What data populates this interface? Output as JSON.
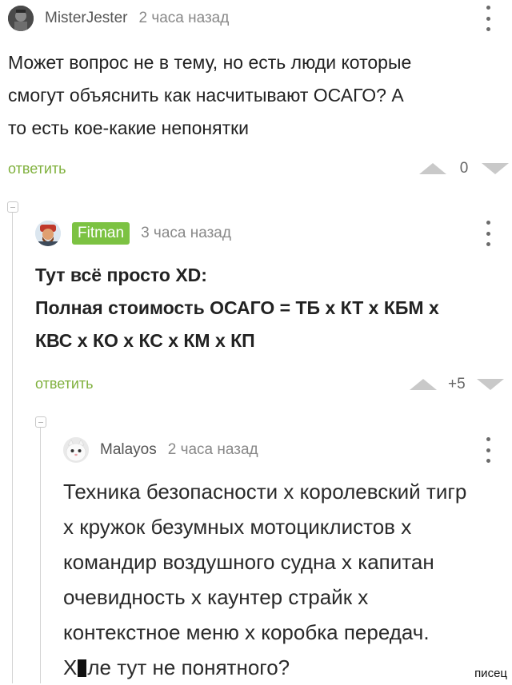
{
  "comments": [
    {
      "author": "MisterJester",
      "time": "2 часа назад",
      "text": "Может вопрос не в тему, но есть люди которые\nсмогут объяснить как насчитывают ОСАГО? А\nто есть кое-какие непонятки",
      "reply_label": "ответить",
      "score": "0"
    },
    {
      "author": "Fitman",
      "time": "3 часа назад",
      "text": "Тут всё просто XD:\nПолная стоимость ОСАГО = ТБ х КТ х КБМ х\nКВС х КО х КС х КМ х КП",
      "reply_label": "ответить",
      "score": "+5"
    },
    {
      "author": "Malayos",
      "time": "2 часа назад",
      "text": "Техника безопасности х королевский тигр\nх кружок безумных мотоциклистов х\nкомандир воздушного судна х капитан\nочевидность х каунтер страйк х\nконтекстное меню х коробка передач.",
      "last_line_start": "Х",
      "last_line_end": "ле тут не понятного?"
    }
  ],
  "watermark": "писец",
  "colors": {
    "reply": "#7fb03c",
    "author_badge": "#7cc242",
    "vote_arrow": "#c9c9c9"
  },
  "icons": [
    "avatar-misterjester",
    "avatar-fitman",
    "avatar-malayos",
    "more-dots-icon",
    "upvote-icon",
    "downvote-icon",
    "collapse-thread-icon"
  ]
}
